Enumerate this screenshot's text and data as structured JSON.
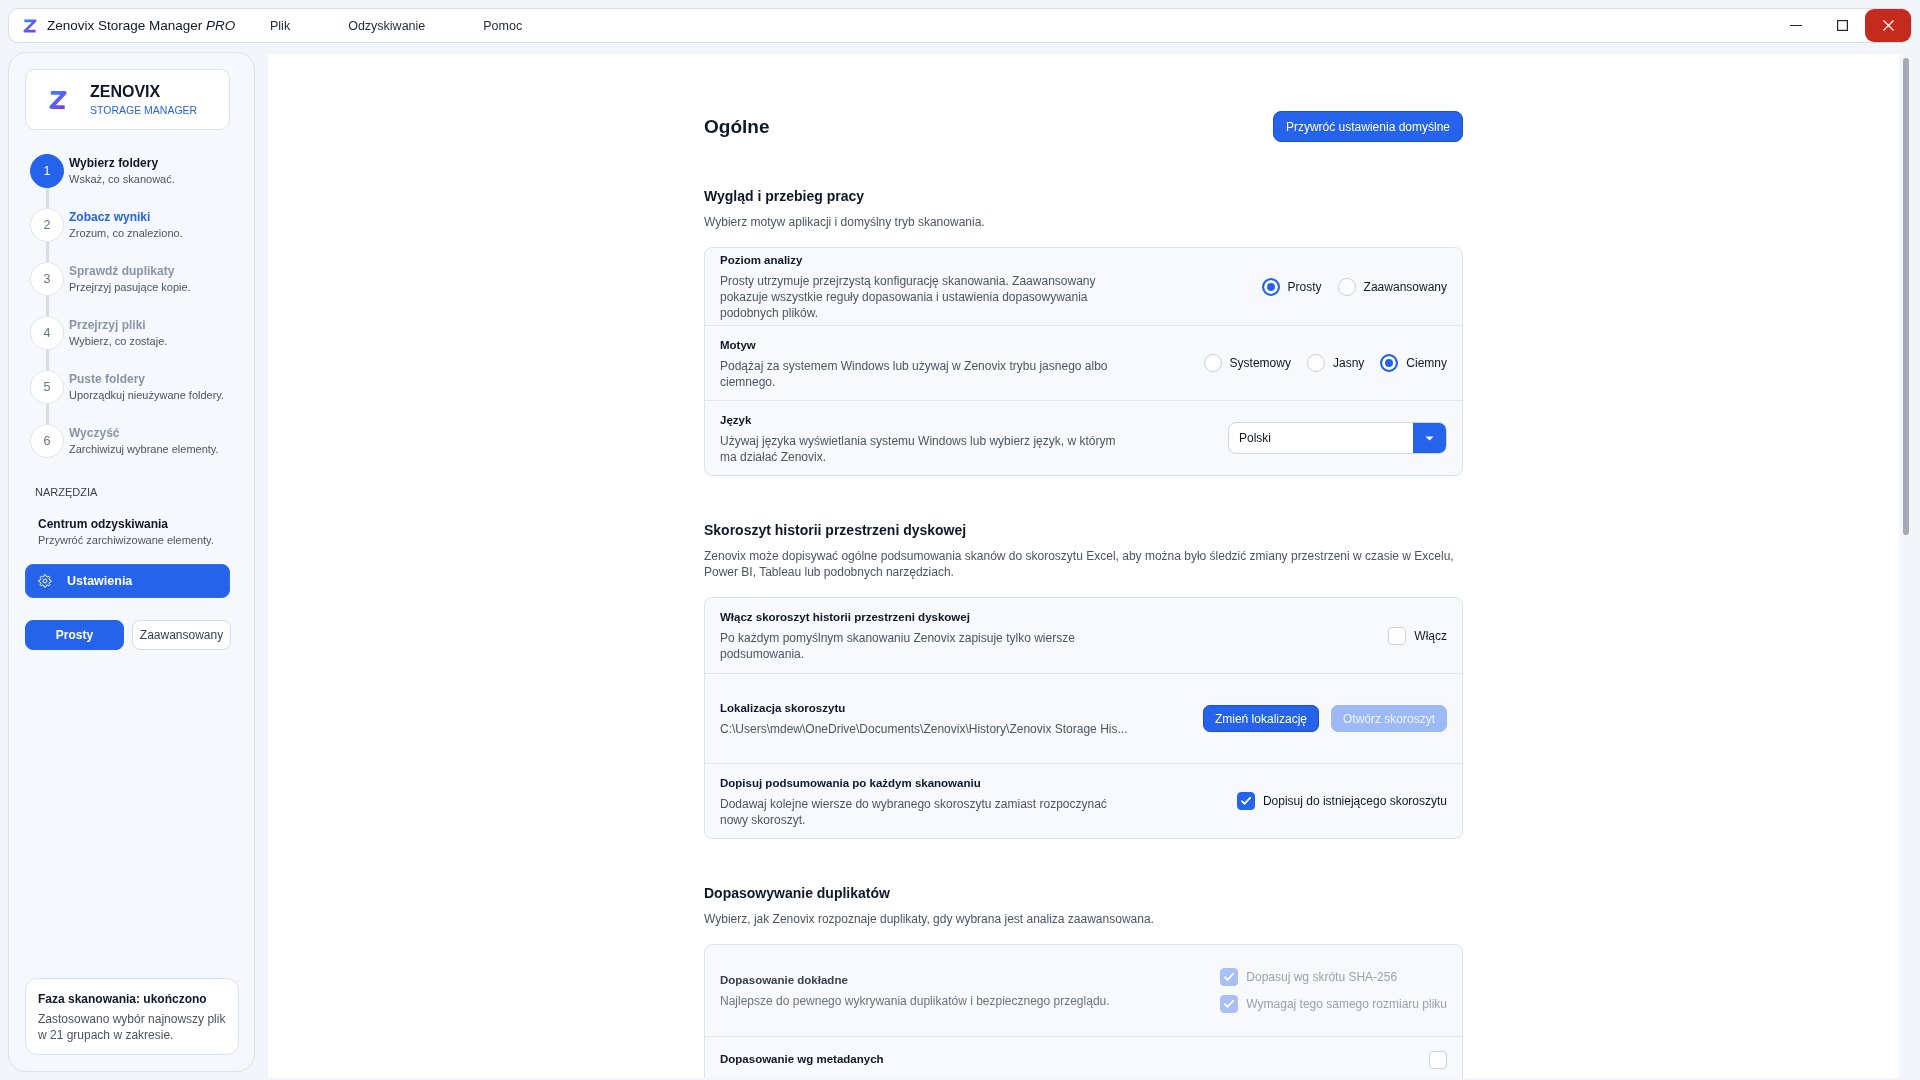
{
  "window": {
    "title": "Zenovix Storage Manager *PRO*",
    "menu": [
      "Plik",
      "Odzyskiwanie",
      "Pomoc"
    ]
  },
  "sidebar": {
    "brand": {
      "name": "ZENOVIX",
      "subtitle": "STORAGE MANAGER"
    },
    "steps": [
      {
        "number": "1",
        "title": "Wybierz foldery",
        "subtitle": "Wskaż, co skanować.",
        "selected": true,
        "disabled": false
      },
      {
        "number": "2",
        "title": "Zobacz wyniki",
        "subtitle": "Zrozum, co znaleziono.",
        "selected": false,
        "disabled": false
      },
      {
        "number": "3",
        "title": "Sprawdź duplikaty",
        "subtitle": "Przejrzyj pasujące kopie.",
        "selected": false,
        "disabled": true
      },
      {
        "number": "4",
        "title": "Przejrzyj pliki",
        "subtitle": "Wybierz, co zostaje.",
        "selected": false,
        "disabled": true
      },
      {
        "number": "5",
        "title": "Puste foldery",
        "subtitle": "Uporządkuj nieużywane foldery.",
        "selected": false,
        "disabled": true
      },
      {
        "number": "6",
        "title": "Wyczyść",
        "subtitle": "Zarchiwizuj wybrane elementy.",
        "selected": false,
        "disabled": true
      }
    ],
    "tools_heading": "NARZĘDZIA",
    "tools": [
      {
        "title": "Centrum odzyskiwania",
        "subtitle": "Przywróć zarchiwizowane elementy."
      }
    ],
    "settings_button": {
      "label": "Ustawienia",
      "selected": true
    },
    "mode_toggle": [
      {
        "label": "Prosty",
        "selected": true
      },
      {
        "label": "Zaawansowany",
        "selected": false
      }
    ],
    "status": {
      "title": "Faza skanowania: ukończono",
      "text": "Zastosowano wybór najnowszy plik w 21 grupach w zakresie."
    }
  },
  "page": {
    "title": "Ogólne",
    "reset_button": "Przywróć ustawienia domyślne",
    "sections": [
      {
        "title": "Wygląd i przebieg pracy",
        "description": "Wybierz motyw aplikacji i domyślny tryb skanowania.",
        "rows": [
          {
            "kind": "radio",
            "title": "Poziom analizy",
            "disabled": false,
            "description": "Prosty utrzymuje przejrzystą konfigurację skanowania. Zaawansowany pokazuje wszystkie reguły dopasowania i ustawienia dopasowywania podobnych plików.",
            "options": [
              {
                "label": "Prosty",
                "selected": true
              },
              {
                "label": "Zaawansowany",
                "selected": false
              }
            ]
          },
          {
            "kind": "radio",
            "title": "Motyw",
            "disabled": false,
            "description": "Podążaj za systemem Windows lub używaj w Zenovix trybu jasnego albo ciemnego.",
            "options": [
              {
                "label": "Systemowy",
                "selected": false
              },
              {
                "label": "Jasny",
                "selected": false
              },
              {
                "label": "Ciemny",
                "selected": true
              }
            ]
          },
          {
            "kind": "select",
            "title": "Język",
            "disabled": false,
            "description": "Używaj języka wyświetlania systemu Windows lub wybierz język, w którym ma działać Zenovix.",
            "value": "Polski"
          }
        ]
      },
      {
        "title": "Skoroszyt historii przestrzeni dyskowej",
        "description": "Zenovix może dopisywać ogólne podsumowania skanów do skoroszytu Excel, aby można było śledzić zmiany przestrzeni w czasie w Excelu, Power BI, Tableau lub podobnych narzędziach.",
        "rows": [
          {
            "kind": "checkbox",
            "title": "Włącz skoroszyt historii przestrzeni dyskowej",
            "disabled": false,
            "description": "Po każdym pomyślnym skanowaniu Zenovix zapisuje tylko wiersze podsumowania.",
            "options": [
              {
                "label": "Włącz",
                "checked": false,
                "disabled": false
              }
            ]
          },
          {
            "kind": "buttons",
            "title": "Lokalizacja skoroszytu",
            "disabled": false,
            "path": "C:\\Users\\mdew\\OneDrive\\Documents\\Zenovix\\History\\Zenovix Storage His...",
            "buttons": [
              {
                "label": "Zmień lokalizację",
                "disabled": false
              },
              {
                "label": "Otwórz skoroszyt",
                "disabled": true
              }
            ]
          },
          {
            "kind": "checkbox",
            "title": "Dopisuj podsumowania po każdym skanowaniu",
            "disabled": false,
            "description": "Dodawaj kolejne wiersze do wybranego skoroszytu zamiast rozpoczynać nowy skoroszyt.",
            "options": [
              {
                "label": "Dopisuj do istniejącego skoroszytu",
                "checked": true,
                "disabled": false
              }
            ]
          }
        ]
      },
      {
        "title": "Dopasowywanie duplikatów",
        "description": "Wybierz, jak Zenovix rozpoznaje duplikaty, gdy wybrana jest analiza zaawansowana.",
        "rows": [
          {
            "kind": "checkbox",
            "title": "Dopasowanie dokładne",
            "disabled": true,
            "description": "Najlepsze do pewnego wykrywania duplikatów i bezpiecznego przeglądu.",
            "options": [
              {
                "label": "Dopasuj wg skrótu SHA-256",
                "checked": true,
                "disabled": true
              },
              {
                "label": "Wymagaj tego samego rozmiaru pliku",
                "checked": true,
                "disabled": true
              }
            ]
          },
          {
            "kind": "checkbox",
            "title": "Dopasowanie wg metadanych",
            "disabled": false,
            "options": [
              {
                "checked": false,
                "disabled": false
              }
            ]
          }
        ]
      }
    ]
  }
}
